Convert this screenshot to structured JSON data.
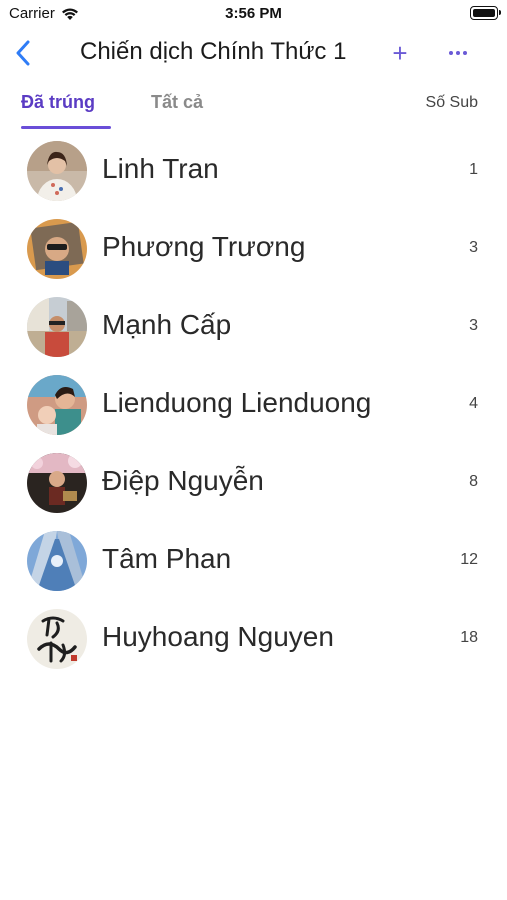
{
  "status_bar": {
    "carrier": "Carrier",
    "time": "3:56 PM"
  },
  "nav": {
    "title": "Chiến dịch Chính Thức 1",
    "add_label": "+",
    "accent_color": "#6a5ad6",
    "back_icon": "chevron-left-icon",
    "more_icon": "ellipsis-icon"
  },
  "tabs": {
    "active": "Đã trúng",
    "inactive": "Tất cả",
    "column_header": "Số Sub"
  },
  "members": [
    {
      "name": "Linh Tran",
      "count": "1"
    },
    {
      "name": "Phương Trương",
      "count": "3"
    },
    {
      "name": "Mạnh Cấp",
      "count": "3"
    },
    {
      "name": "Lienduong Lienduong",
      "count": "4"
    },
    {
      "name": "Điệp Nguyễn",
      "count": "8"
    },
    {
      "name": "Tâm Phan",
      "count": "12"
    },
    {
      "name": "Huyhoang Nguyen",
      "count": "18"
    }
  ]
}
